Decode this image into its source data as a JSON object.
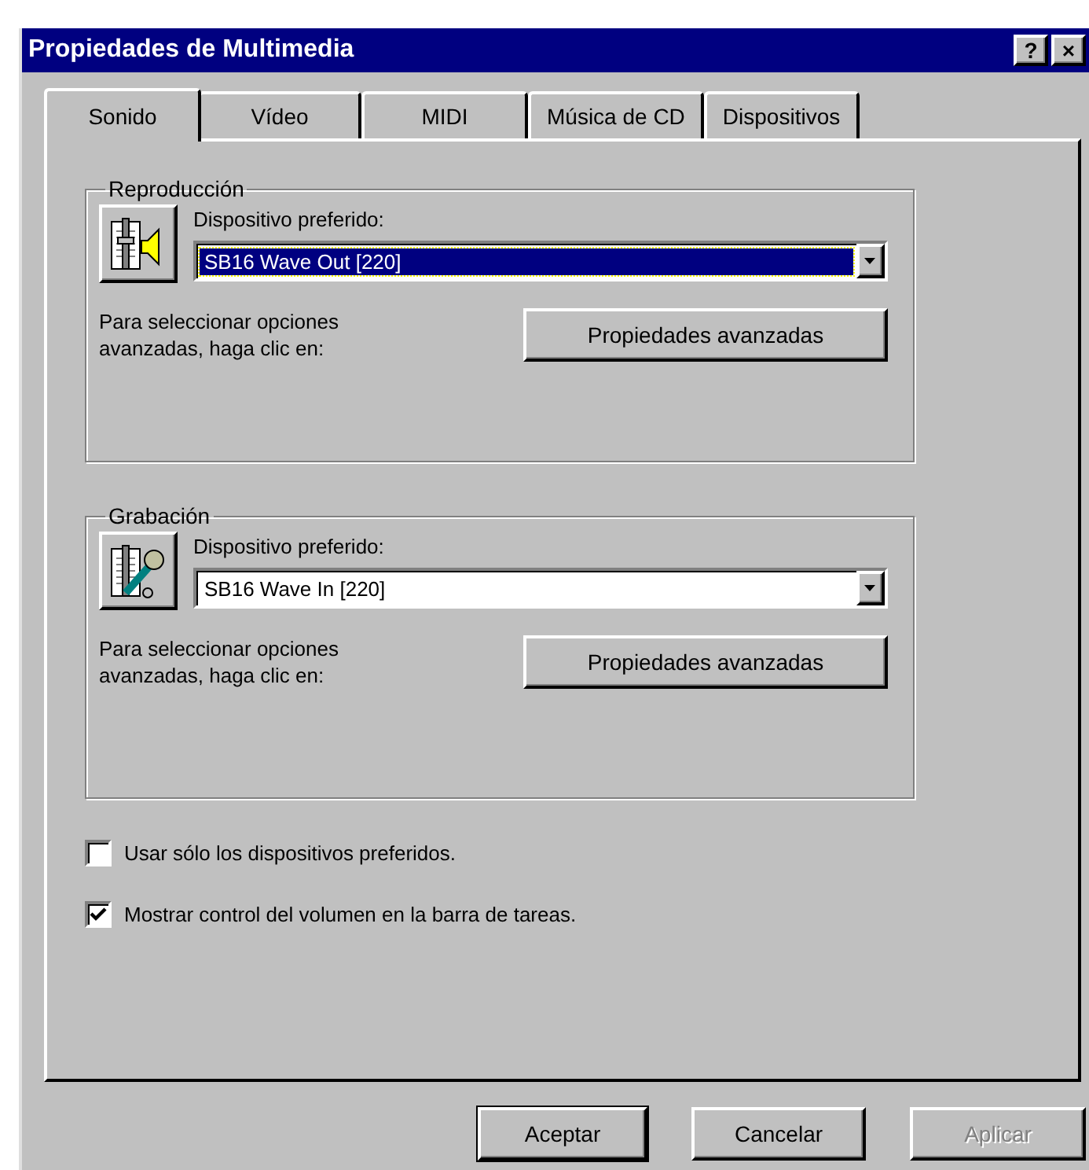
{
  "window": {
    "title": "Propiedades de Multimedia",
    "title_buttons": [
      "?",
      "×"
    ]
  },
  "tabs": [
    {
      "label": "Sonido",
      "selected": true
    },
    {
      "label": "Vídeo",
      "selected": false
    },
    {
      "label": "MIDI",
      "selected": false
    },
    {
      "label": "Música de CD",
      "selected": false
    },
    {
      "label": "Dispositivos",
      "selected": false
    }
  ],
  "groups": [
    {
      "title": "Reproducción",
      "kind": "speaker",
      "device_label": "Dispositivo preferido:",
      "device": {
        "value": "SB16 Wave Out [220]",
        "focused": true
      },
      "hint": "Para seleccionar opciones avanzadas, haga clic en:",
      "button": "Propiedades avanzadas"
    },
    {
      "title": "Grabación",
      "kind": "microphone",
      "device_label": "Dispositivo preferido:",
      "device": {
        "value": "SB16 Wave In [220]",
        "focused": false
      },
      "hint": "Para seleccionar opciones avanzadas, haga clic en:",
      "button": "Propiedades avanzadas"
    }
  ],
  "options": [
    {
      "label": "Usar sólo los dispositivos preferidos.",
      "checked": false
    },
    {
      "label": "Mostrar control del volumen en la barra de tareas.",
      "checked": true
    }
  ],
  "buttons": [
    {
      "label": "Aceptar",
      "disabled": false,
      "default": true
    },
    {
      "label": "Cancelar",
      "disabled": false,
      "default": false
    },
    {
      "label": "Aplicar",
      "disabled": true,
      "default": false
    }
  ]
}
